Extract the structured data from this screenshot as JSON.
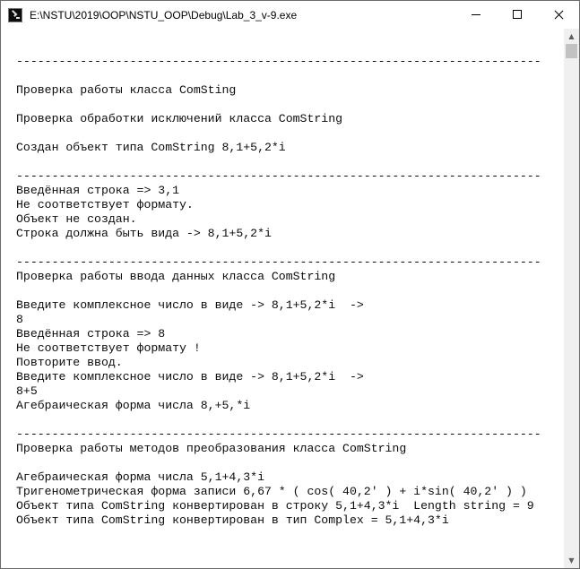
{
  "window": {
    "title": "E:\\NSTU\\2019\\OOP\\NSTU_OOP\\Debug\\Lab_3_v-9.exe"
  },
  "icons": {
    "app": "console-app-icon",
    "minimize": "minimize-icon",
    "maximize": "maximize-icon",
    "close": "close-icon",
    "scroll_up": "scroll-up-arrow-icon",
    "scroll_down": "scroll-down-arrow-icon"
  },
  "scrollbar": {
    "up_glyph": "▲",
    "down_glyph": "▼"
  },
  "console": {
    "lines": [
      "",
      "--------------------------------------------------------------------------",
      "",
      "Проверка работы класса ComSting",
      "",
      "Проверка обработки исключений класса ComString",
      "",
      "Создан объект типа ComString 8,1+5,2*i",
      "",
      "--------------------------------------------------------------------------",
      "Введённая строка => 3,1",
      "Не соответствует формату.",
      "Объект не создан.",
      "Строка должна быть вида -> 8,1+5,2*i",
      "",
      "--------------------------------------------------------------------------",
      "Проверка работы ввода данных класса ComString",
      "",
      "Введите комплексное число в виде -> 8,1+5,2*i  ->",
      "8",
      "Введённая строка => 8",
      "Не соответствует формату !",
      "Повторите ввод.",
      "Введите комплексное число в виде -> 8,1+5,2*i  ->",
      "8+5",
      "Агебраическая форма числа 8,+5,*i",
      "",
      "--------------------------------------------------------------------------",
      "Проверка работы методов преобразования класса ComString",
      "",
      "Агебраическая форма числа 5,1+4,3*i",
      "Тригенометрическая форма записи 6,67 * ( cos( 40,2' ) + i*sin( 40,2' ) )",
      "Объект типа ComString конвертирован в строку 5,1+4,3*i  Length string = 9",
      "Объект типа ComString конвертирован в тип Complex = 5,1+4,3*i"
    ]
  }
}
